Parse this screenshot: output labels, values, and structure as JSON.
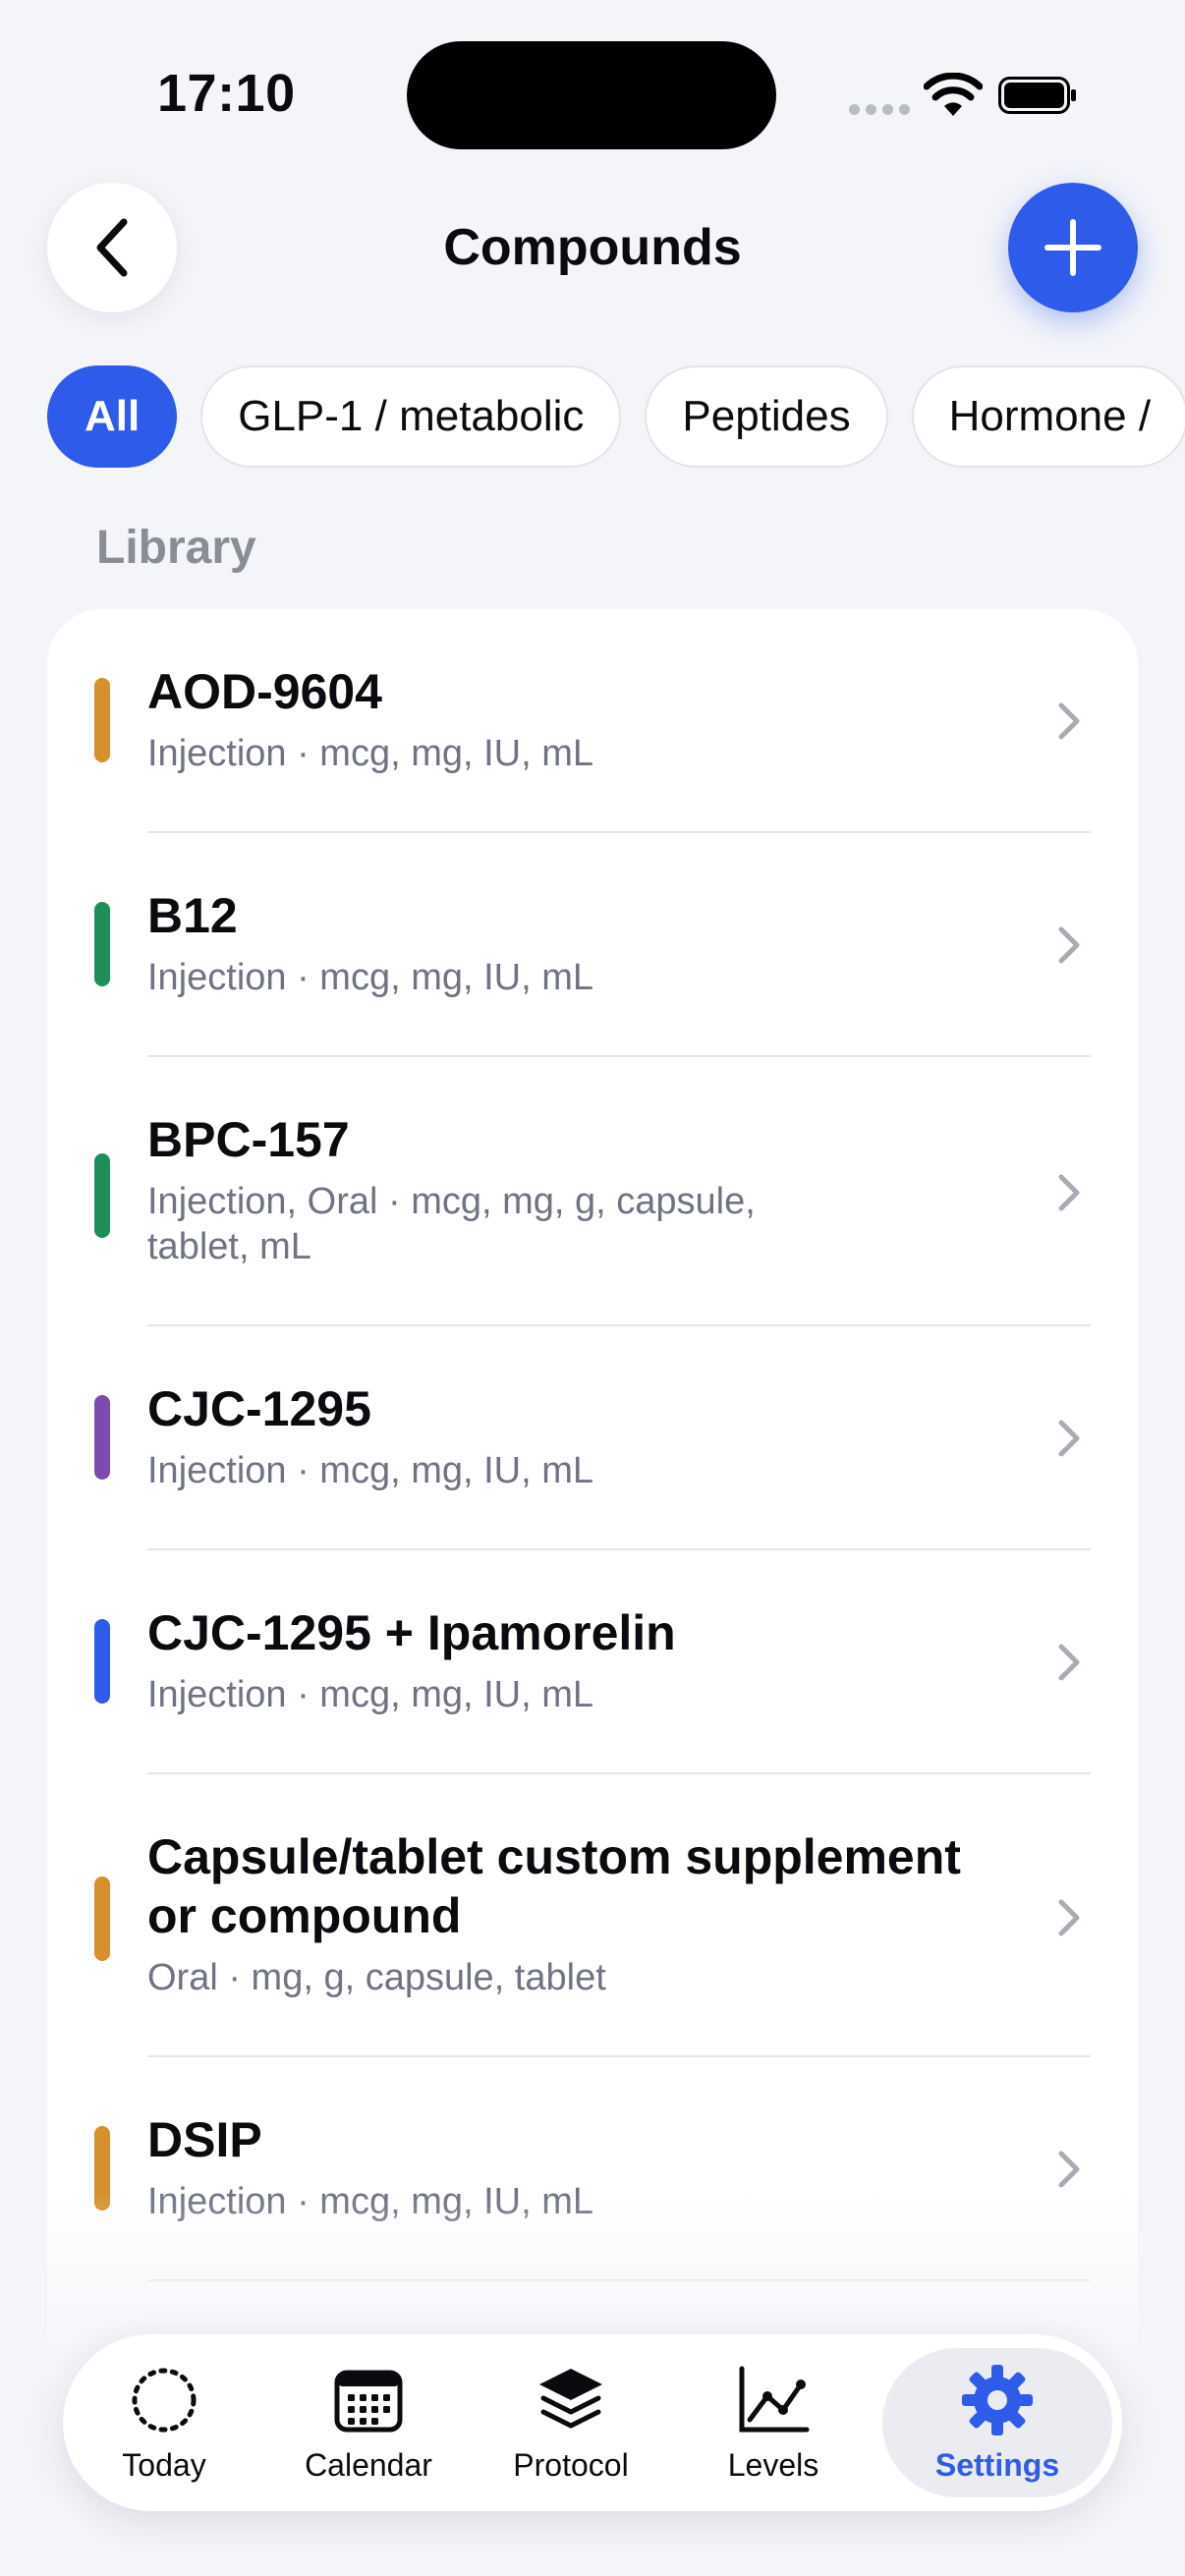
{
  "status_bar": {
    "time": "17:10"
  },
  "header": {
    "title": "Compounds"
  },
  "filters": [
    "All",
    "GLP-1 / metabolic",
    "Peptides",
    "Hormone /"
  ],
  "library": {
    "section_label": "Library",
    "items": [
      {
        "name": "AOD-9604",
        "meta": "Injection · mcg, mg, IU, mL",
        "color": "#d8902b"
      },
      {
        "name": "B12",
        "meta": "Injection · mcg, mg, IU, mL",
        "color": "#1f8f5a"
      },
      {
        "name": "BPC-157",
        "meta_line1": "Injection, Oral · mcg, mg, g, capsule,",
        "meta_line2": "tablet, mL",
        "color": "#1f8f5a"
      },
      {
        "name": "CJC-1295",
        "meta": "Injection · mcg, mg, IU, mL",
        "color": "#7d4bb0"
      },
      {
        "name": "CJC-1295 + Ipamorelin",
        "meta": "Injection · mcg, mg, IU, mL",
        "color": "#2f5bea"
      },
      {
        "name_line1": "Capsule/tablet custom supplement",
        "name_line2": "or compound",
        "meta": "Oral · mg, g, capsule, tablet",
        "color": "#d8902b"
      },
      {
        "name": "DSIP",
        "meta": "Injection · mcg, mg, IU, mL",
        "color": "#d8902b"
      }
    ]
  },
  "tab_bar": {
    "tabs": [
      {
        "label": "Today"
      },
      {
        "label": "Calendar"
      },
      {
        "label": "Protocol"
      },
      {
        "label": "Levels"
      },
      {
        "label": "Settings"
      }
    ],
    "active_index": 4
  },
  "colors": {
    "accent": "#2f5bea",
    "background": "#f4f5f9"
  }
}
